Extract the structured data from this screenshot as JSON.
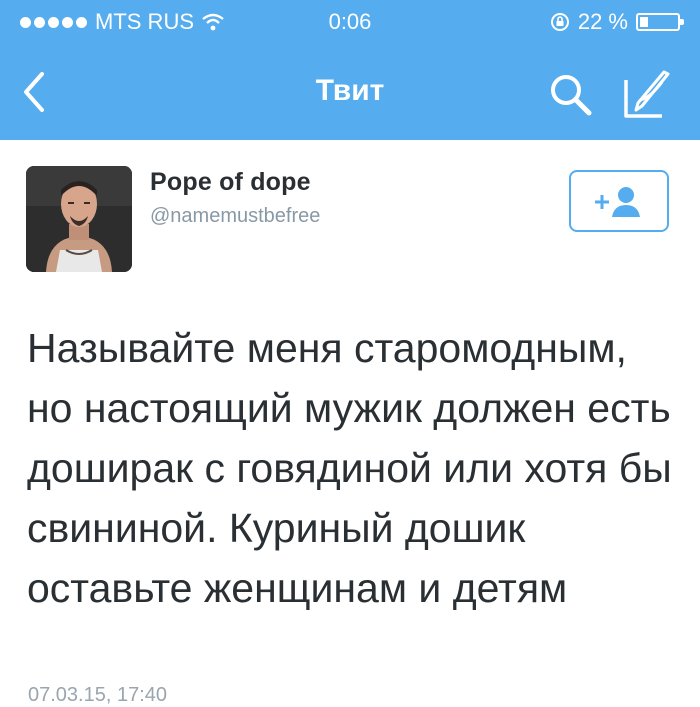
{
  "status_bar": {
    "carrier": "MTS RUS",
    "time": "0:06",
    "battery_percent": "22 %",
    "battery_level": 0.22,
    "signal_dots": 5
  },
  "nav": {
    "title": "Твит",
    "back_icon": "chevron-left-icon",
    "search_icon": "search-icon",
    "compose_icon": "compose-icon"
  },
  "tweet": {
    "author_name": "Pope of dope",
    "author_handle": "@namemustbefree",
    "text": "Называйте меня старомодным, но настоящий мужик должен есть доширак с говядиной или хотя бы свининой. Куриный дошик оставьте женщинам и детям",
    "timestamp": "07.03.15, 17:40"
  },
  "colors": {
    "brand": "#55acee",
    "text": "#292f33",
    "muted": "#8899a6"
  }
}
